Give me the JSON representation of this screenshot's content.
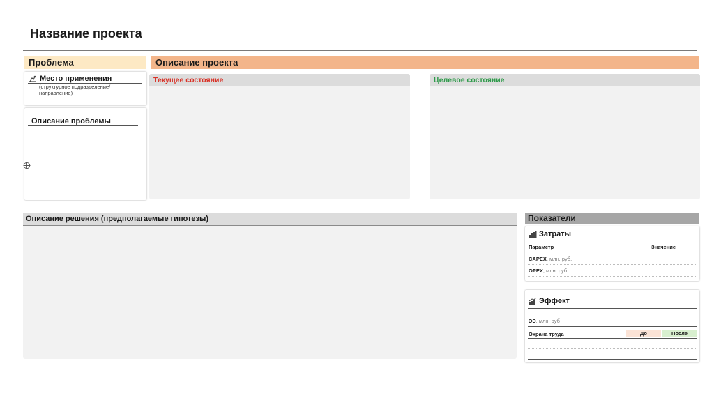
{
  "page": {
    "title": "Название проекта"
  },
  "problem": {
    "header": "Проблема",
    "place": {
      "title": "Место применения",
      "subtitle": "(структурное подразделение/направление)"
    },
    "description": {
      "title": "Описание проблемы"
    }
  },
  "project": {
    "header": "Описание проекта",
    "current_state": {
      "label": "Текущее состояние",
      "color": "#d93025"
    },
    "target_state": {
      "label": "Целевое состояние",
      "color": "#2e9a4a"
    }
  },
  "solution": {
    "label": "Описание решения (предполагаемые гипотезы)"
  },
  "indicators": {
    "header": "Показатели",
    "costs": {
      "title": "Затраты",
      "col_param": "Параметр",
      "col_value": "Значение",
      "rows": [
        {
          "name": "CAPEX",
          "unit": ", млн. руб."
        },
        {
          "name": "OPEX",
          "unit": ", млн. руб."
        }
      ]
    },
    "effect": {
      "title": "Эффект",
      "ee": {
        "name": "ЭЭ",
        "unit": ", млн. руб"
      },
      "safety": "Охрана труда",
      "before": "До",
      "after": "После",
      "before_color": "#fbe3d6",
      "after_color": "#d8efcf"
    }
  }
}
